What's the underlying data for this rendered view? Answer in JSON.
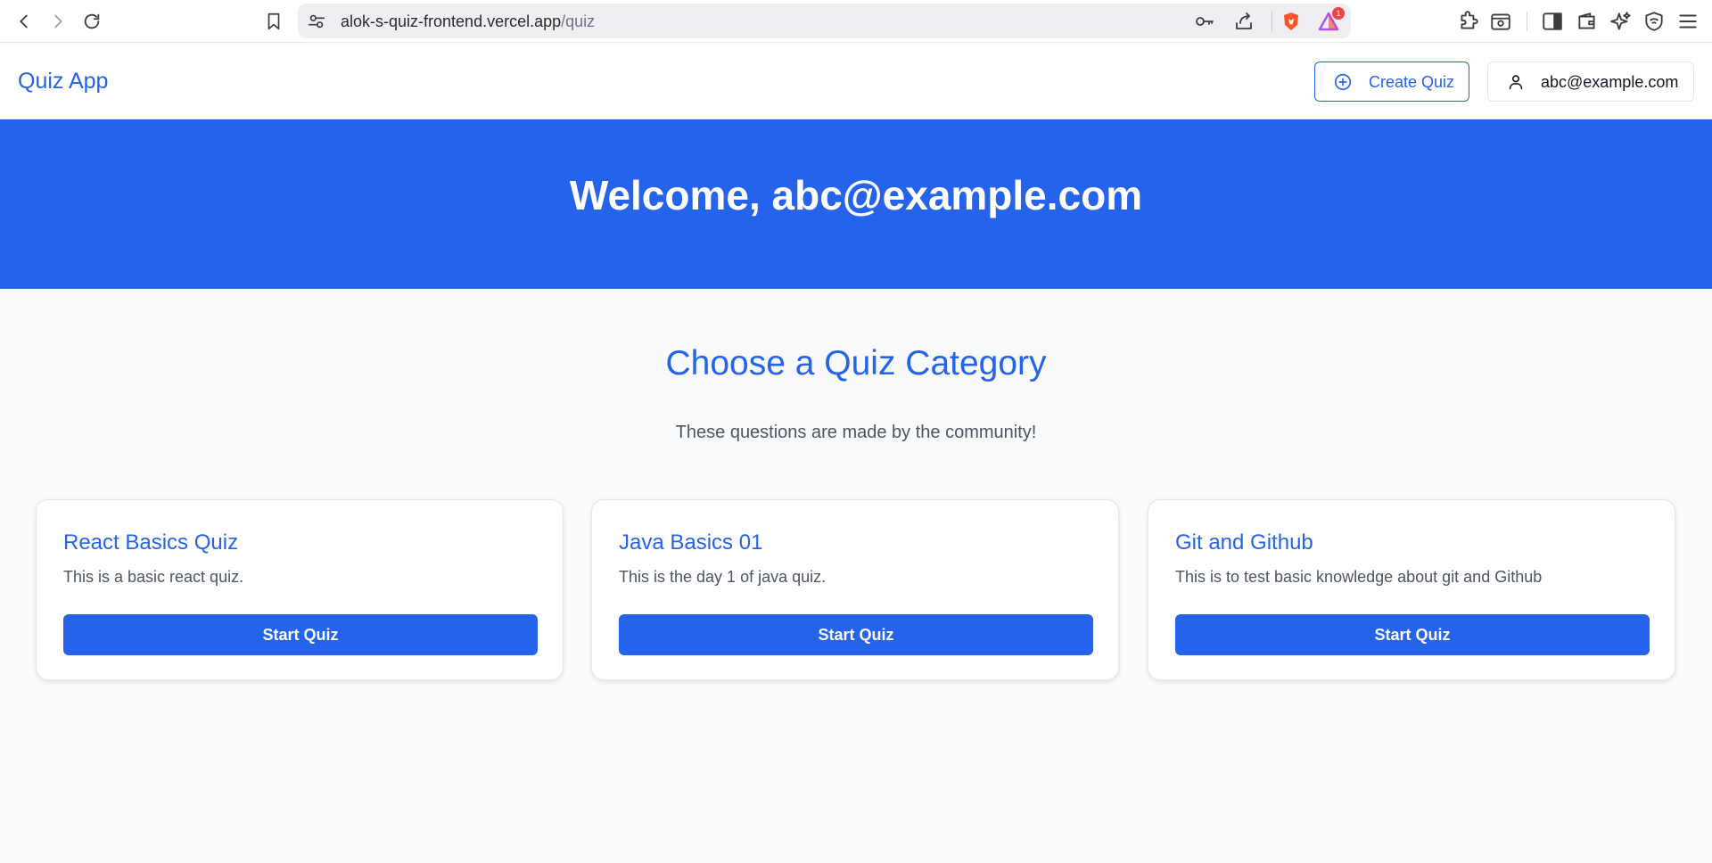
{
  "browser": {
    "url_host": "alok-s-quiz-frontend.vercel.app",
    "url_path": "/quiz",
    "brave_badge_count": "1",
    "icons": [
      "back-icon",
      "forward-icon",
      "reload-icon",
      "bookmark-icon",
      "site-settings-icon",
      "key-icon",
      "share-icon",
      "brave-shields-icon",
      "brave-rewards-icon",
      "extensions-icon",
      "screenshot-icon",
      "sidebar-icon",
      "wallet-icon",
      "leo-ai-icon",
      "vpn-icon",
      "menu-icon"
    ]
  },
  "header": {
    "brand": "Quiz App",
    "create_label": "Create Quiz",
    "user_email": "abc@example.com"
  },
  "hero": {
    "title": "Welcome, abc@example.com"
  },
  "main": {
    "title": "Choose a Quiz Category",
    "subtitle": "These questions are made by the community!",
    "cards": [
      {
        "title": "React Basics Quiz",
        "description": "This is a basic react quiz.",
        "button": "Start Quiz"
      },
      {
        "title": "Java Basics 01",
        "description": "This is the day 1 of java quiz.",
        "button": "Start Quiz"
      },
      {
        "title": "Git and Github",
        "description": "This is to test basic knowledge about git and Github",
        "button": "Start Quiz"
      }
    ]
  },
  "colors": {
    "primary": "#2563eb",
    "page_bg": "#f8fafc",
    "brave_orange": "#fb542b"
  }
}
